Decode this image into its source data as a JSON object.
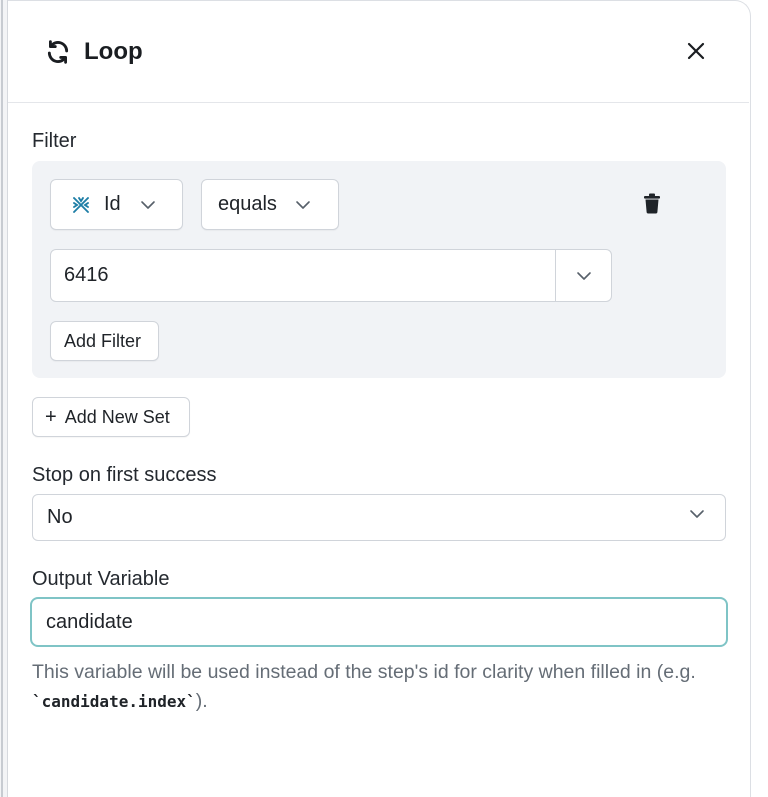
{
  "panel": {
    "title": "Loop",
    "title_icon": "refresh-icon",
    "close_icon": "close-icon"
  },
  "filter": {
    "label": "Filter",
    "field": {
      "label": "Id",
      "icon": "crossed-arrows-icon",
      "icon_color": "#1e7ea6"
    },
    "operator": {
      "label": "equals"
    },
    "value": "6416",
    "add_filter_label": "Add Filter",
    "delete_icon": "trash-icon"
  },
  "add_set": {
    "plus": "+",
    "label": "Add New Set"
  },
  "stop_on_first_success": {
    "label": "Stop on first success",
    "value": "No"
  },
  "output_variable": {
    "label": "Output Variable",
    "value": "candidate",
    "help_prefix": "This variable will be used instead of the step's id for clarity when filled in (e.g. ",
    "help_code": "`candidate.index`",
    "help_suffix": ")."
  },
  "colors": {
    "focus_border": "#7fc4c6",
    "filter_bg": "#f1f3f6",
    "muted_text": "#656d76"
  }
}
